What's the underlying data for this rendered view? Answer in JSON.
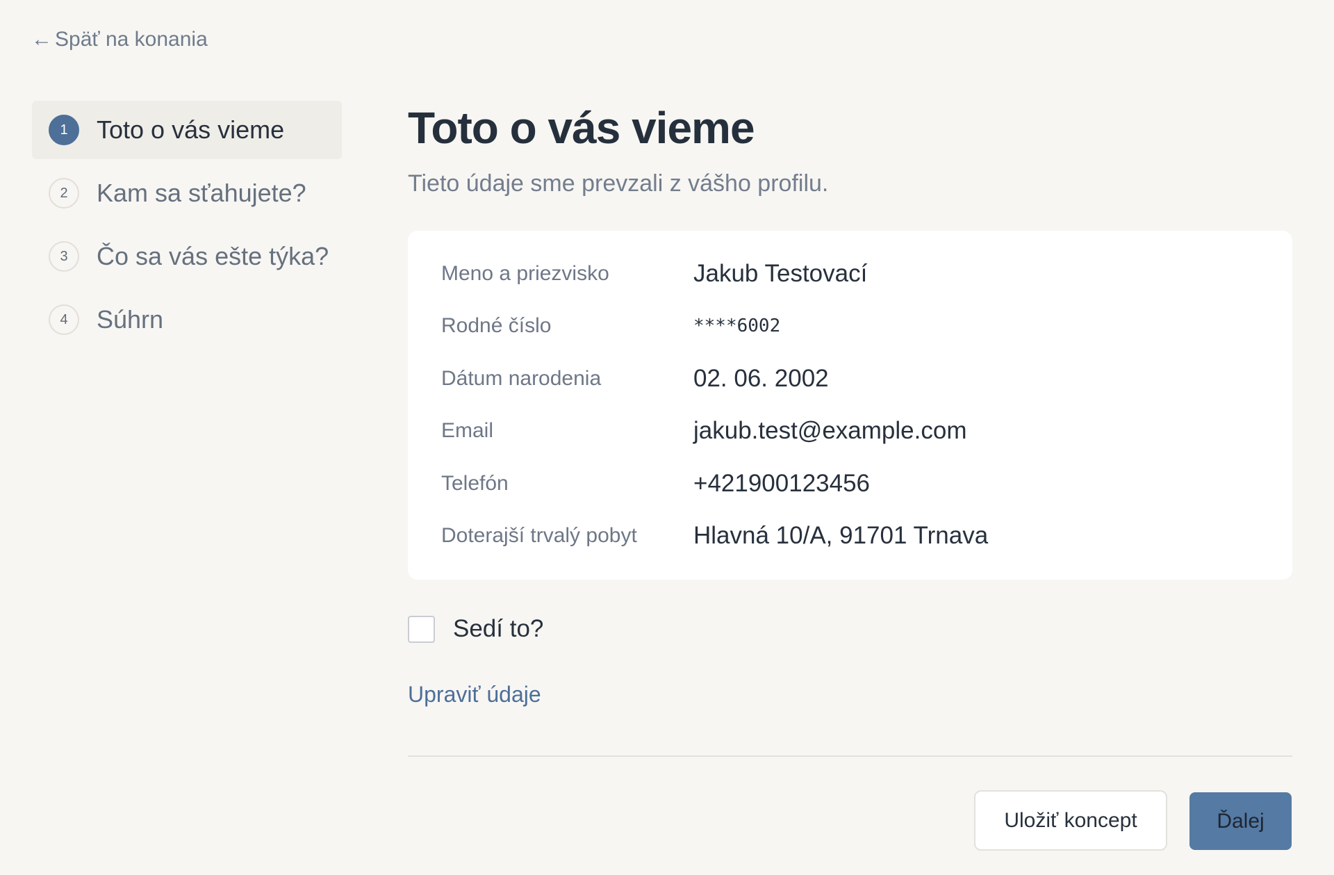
{
  "nav": {
    "back_arrow": "←",
    "back_label": "Späť na konania",
    "arrow_icon": "arrow-left-icon"
  },
  "steps": [
    {
      "number": "1",
      "label": "Toto o vás vieme",
      "active": true
    },
    {
      "number": "2",
      "label": "Kam sa sťahujete?",
      "active": false
    },
    {
      "number": "3",
      "label": "Čo sa vás ešte týka?",
      "active": false
    },
    {
      "number": "4",
      "label": "Súhrn",
      "active": false
    }
  ],
  "main": {
    "title": "Toto o vás vieme",
    "subtitle": "Tieto údaje sme prevzali z vášho profilu."
  },
  "profile": [
    {
      "label": "Meno a priezvisko",
      "value": "Jakub Testovací"
    },
    {
      "label": "Rodné číslo",
      "value": "****6002"
    },
    {
      "label": "Dátum narodenia",
      "value": "02. 06. 2002"
    },
    {
      "label": "Email",
      "value": "jakub.test@example.com"
    },
    {
      "label": "Telefón",
      "value": "+421900123456"
    },
    {
      "label": "Doterajší trvalý pobyt",
      "value": "Hlavná 10/A, 91701 Trnava"
    }
  ],
  "confirm": {
    "label": "Sedí to?",
    "checked": false
  },
  "edit_link": "Upraviť údaje",
  "actions": {
    "save_draft": "Uložiť koncept",
    "next": "Ďalej"
  },
  "colors": {
    "accent": "#4d6f98",
    "primary_button": "#557aa3",
    "background": "#f7f6f3"
  }
}
